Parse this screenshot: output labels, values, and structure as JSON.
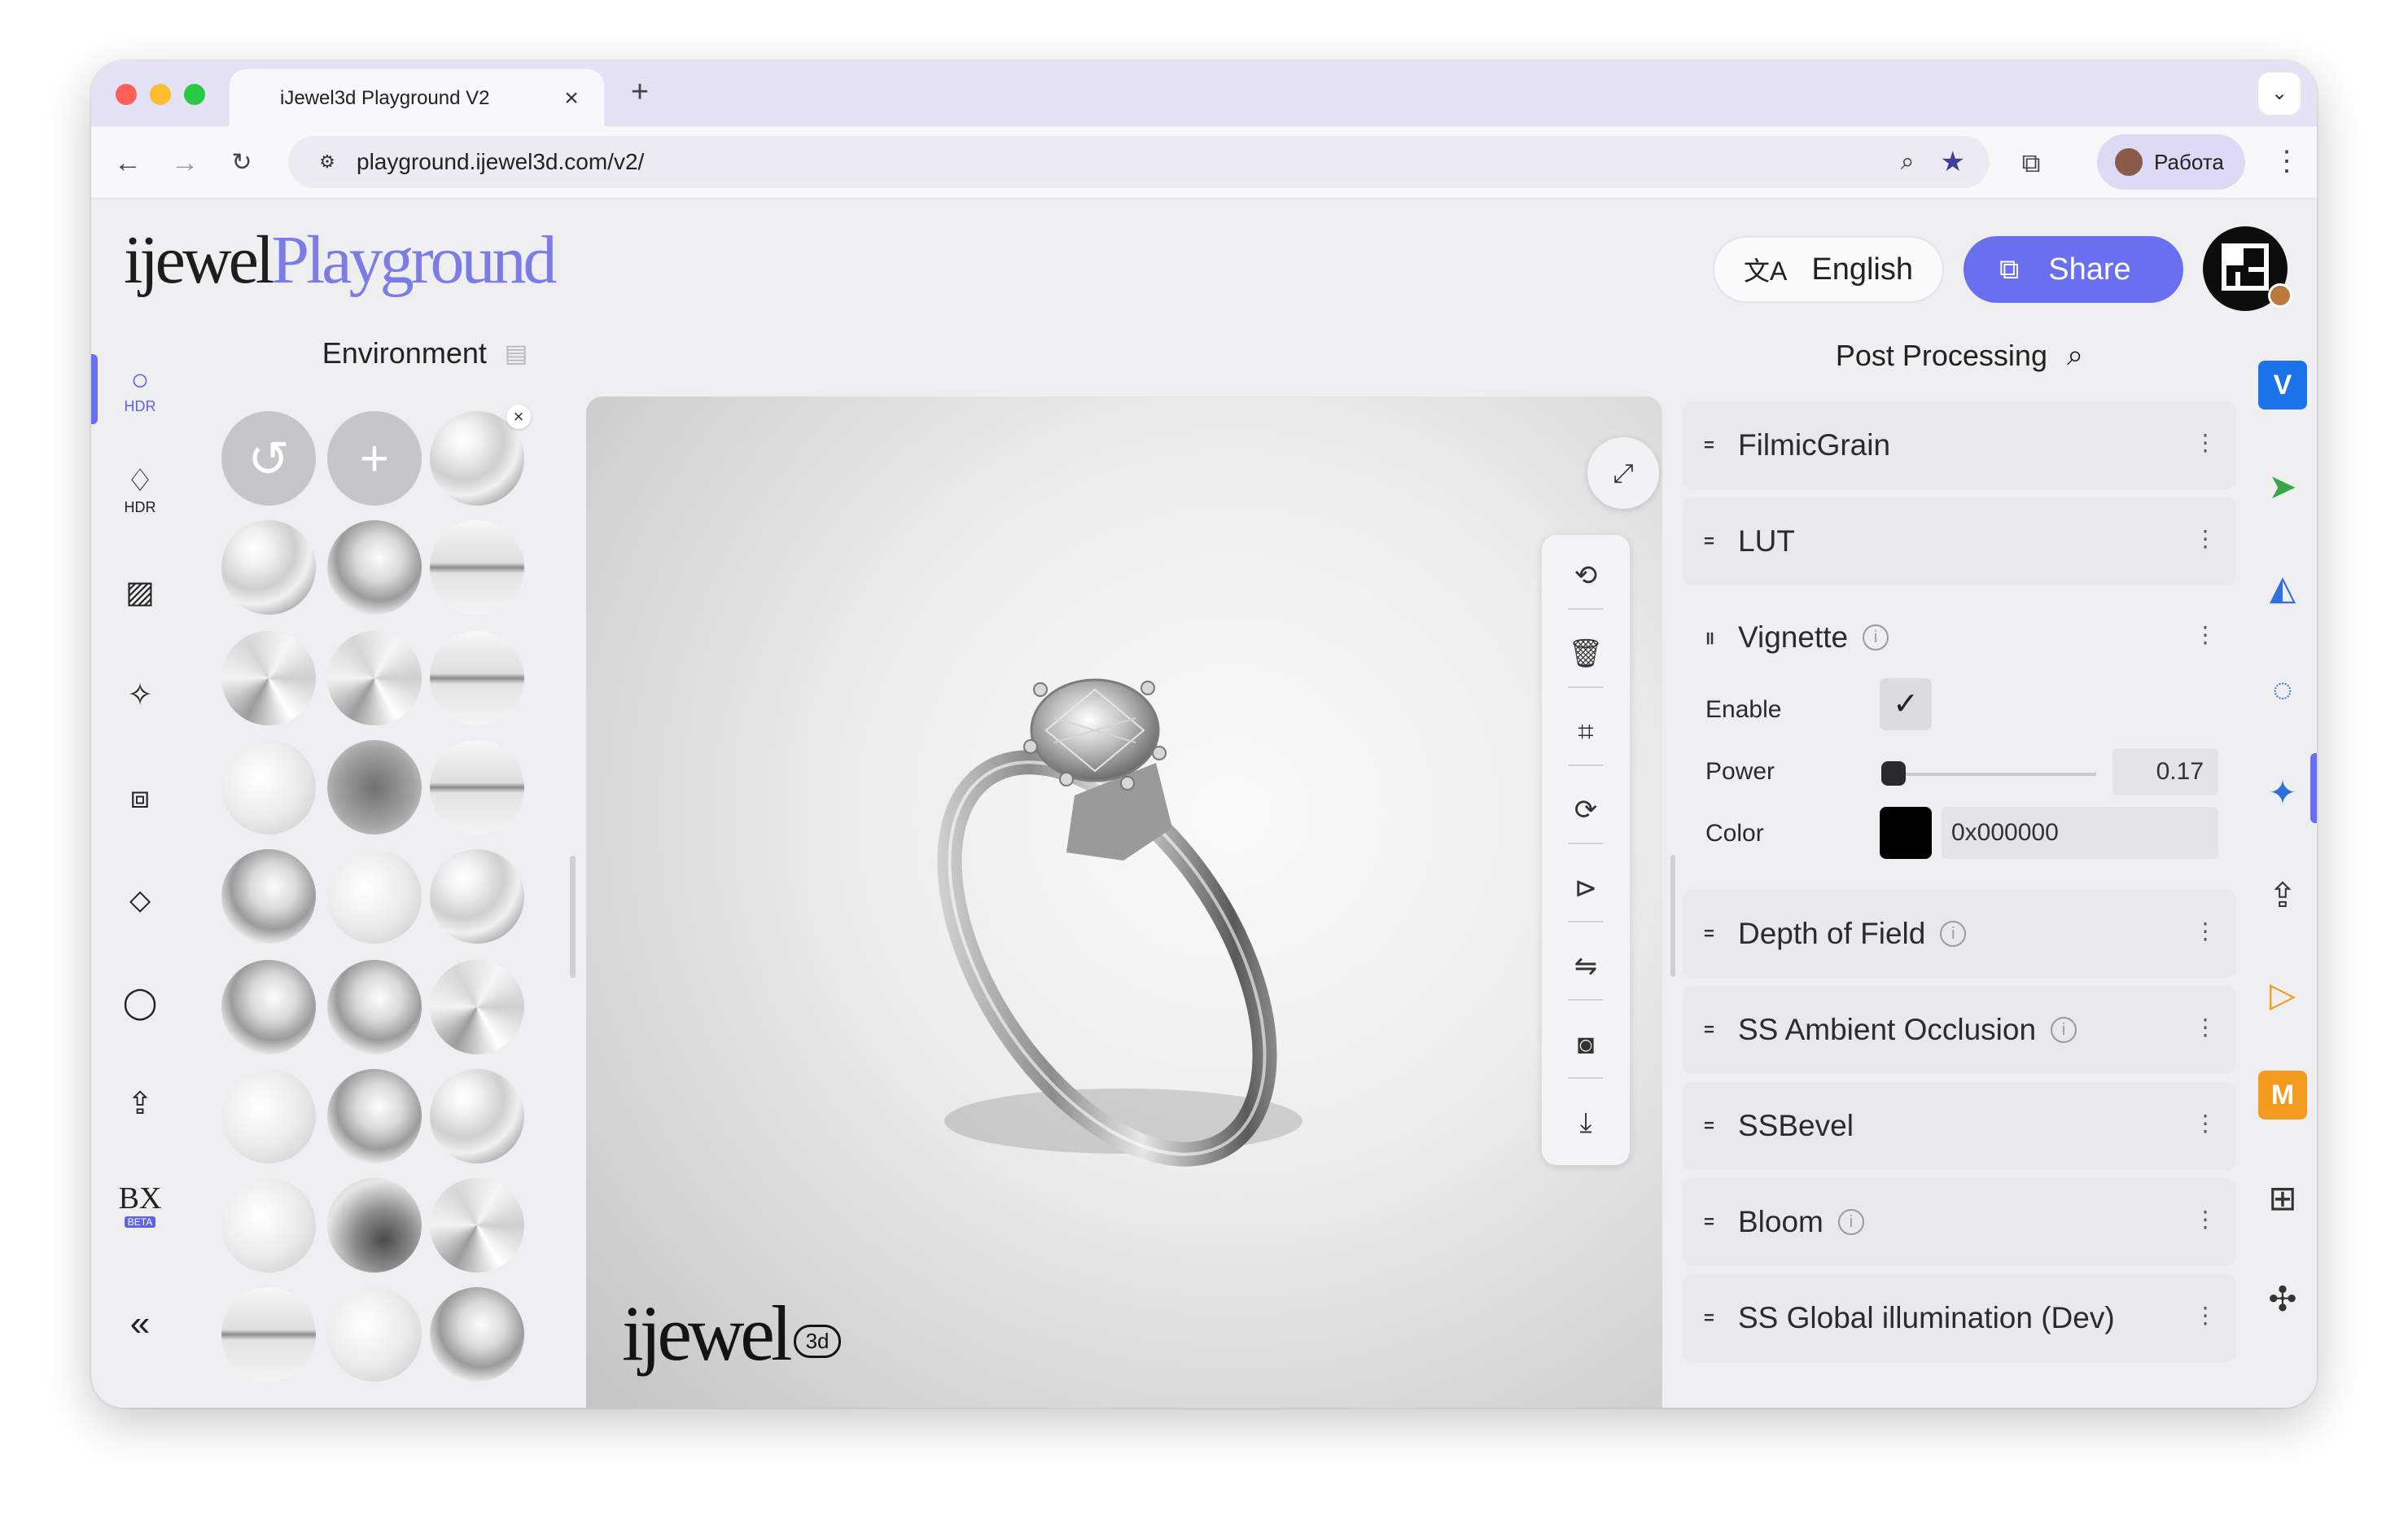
{
  "browser": {
    "tab_title": "iJewel3d Playground V2",
    "url": "playground.ijewel3d.com/v2/",
    "profile_name": "Работа"
  },
  "header": {
    "logo_word1": "ijewel",
    "logo_word2": "Playground",
    "language": "English",
    "share": "Share"
  },
  "left_rail": {
    "items": [
      {
        "icon": "hdr-circle-icon",
        "label": "HDR",
        "active": true
      },
      {
        "icon": "hdr-diamond-icon",
        "label": "HDR"
      },
      {
        "icon": "hatch-icon",
        "label": ""
      },
      {
        "icon": "sparkle-icon",
        "label": ""
      },
      {
        "icon": "ring-box-icon",
        "label": ""
      },
      {
        "icon": "diamond-flat-icon",
        "label": ""
      },
      {
        "icon": "ring-icon",
        "label": ""
      },
      {
        "icon": "upload-icon",
        "label": ""
      },
      {
        "icon": "bx-beta-icon",
        "label": "BETA"
      }
    ]
  },
  "environment": {
    "title": "Environment"
  },
  "viewport": {
    "watermark": "ijewel",
    "watermark_badge": "3d"
  },
  "post_processing": {
    "title": "Post Processing",
    "items": [
      {
        "label": "FilmicGrain",
        "info": false
      },
      {
        "label": "LUT",
        "info": false
      },
      {
        "label": "Vignette",
        "info": true,
        "expanded": true
      },
      {
        "label": "Depth of Field",
        "info": true
      },
      {
        "label": "SS Ambient Occlusion",
        "info": true
      },
      {
        "label": "SSBevel",
        "info": false
      },
      {
        "label": "Bloom",
        "info": true
      },
      {
        "label": "SS Global illumination (Dev)",
        "info": false
      }
    ],
    "vignette": {
      "enable_label": "Enable",
      "enabled": true,
      "power_label": "Power",
      "power": "0.17",
      "color_label": "Color",
      "color": "0x000000"
    }
  },
  "right_rail": {
    "items": [
      {
        "icon": "v-badge-icon",
        "text": "V",
        "color": "#1a73e8"
      },
      {
        "icon": "cursor-icon",
        "color": "#3aa64a"
      },
      {
        "icon": "shapes-icon",
        "color": "#2f6fe0"
      },
      {
        "icon": "refresh-circle-icon",
        "color": "#2f6fe0"
      },
      {
        "icon": "sparkle-icon",
        "color": "#2f6fe0",
        "active": true
      },
      {
        "icon": "upload-box-icon",
        "color": "#333333"
      },
      {
        "icon": "play-icon",
        "color": "#f29b1f"
      },
      {
        "icon": "m-badge-icon",
        "text": "M",
        "color": "#f29b1f"
      },
      {
        "icon": "grid-icon",
        "color": "#333333"
      },
      {
        "icon": "puzzle-icon",
        "color": "#333333"
      }
    ]
  }
}
